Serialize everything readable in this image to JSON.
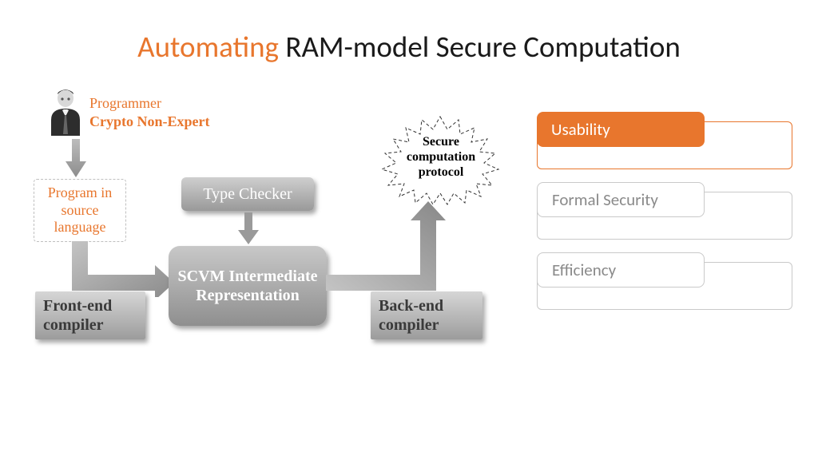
{
  "title": {
    "accent": "Automating",
    "rest": " RAM-model Secure Computation"
  },
  "programmer": {
    "label": "Programmer",
    "sublabel": "Crypto Non-Expert"
  },
  "source_box": "Program in source language",
  "boxes": {
    "type_checker": "Type Checker",
    "scvm": "SCVM Intermediate Representation",
    "frontend": "Front-end compiler",
    "backend": "Back-end compiler"
  },
  "starburst": "Secure computation protocol",
  "tabs": {
    "usability": "Usability",
    "formal_security": "Formal Security",
    "efficiency": "Efficiency"
  }
}
